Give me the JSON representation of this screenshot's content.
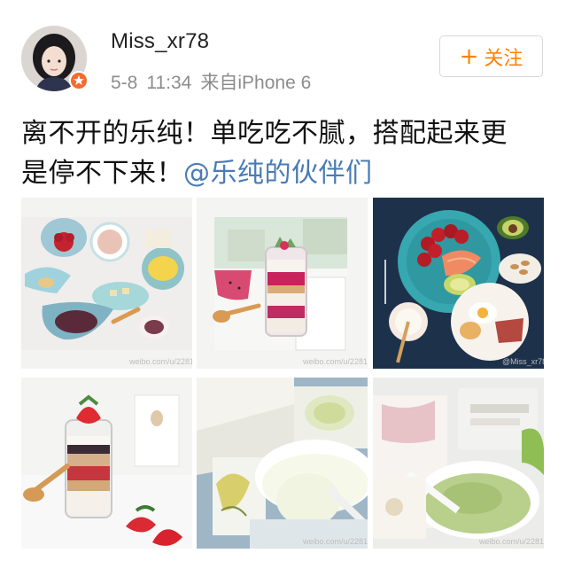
{
  "post": {
    "username": "Miss_xr78",
    "date": "5-8",
    "time": "11:34",
    "source": "来自iPhone 6",
    "follow_label": "关注",
    "follow_plus": "+",
    "text_line1": "离不开的乐纯！单吃吃不腻，搭配起来更",
    "text_line2_prefix": "是停不下来！",
    "mention": "@乐纯的伙伴们"
  },
  "images": [
    {
      "id": 1,
      "icon": "breakfast-spread-photo",
      "watermark": "weibo.com/u/2281..."
    },
    {
      "id": 2,
      "icon": "dragonfruit-parfait-jar-photo",
      "watermark": "weibo.com/u/2281..."
    },
    {
      "id": 3,
      "icon": "fruit-plate-breakfast-photo",
      "watermark": "@Miss_xr78"
    },
    {
      "id": 4,
      "icon": "strawberry-parfait-jar-photo",
      "watermark": ""
    },
    {
      "id": 5,
      "icon": "durian-yogurt-cup-photo",
      "watermark": "weibo.com/u/2281..."
    },
    {
      "id": 6,
      "icon": "matcha-yogurt-cup-photo",
      "watermark": "weibo.com/u/2281..."
    }
  ],
  "colors": {
    "follow": "#ff8200",
    "mention": "#4a7bb4",
    "badge": "#f26c2f",
    "meta": "#8c8c8c"
  }
}
